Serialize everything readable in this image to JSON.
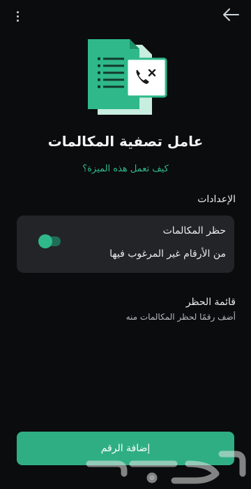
{
  "header": {
    "menu_icon": "more-vertical-icon",
    "back_icon": "arrow-left-icon"
  },
  "illustration": {
    "icon": "blocked-call-document-icon",
    "accent_color": "#2fb98b"
  },
  "page": {
    "title": "عامل تصفية المكالمات",
    "help_link": "كيف تعمل هذه الميزة؟"
  },
  "settings": {
    "heading": "الإعدادات",
    "call_block": {
      "title": "حظر المكالمات",
      "subtitle": "من الأرقام غير المرغوب فيها",
      "enabled": true
    },
    "block_list": {
      "title": "قائمة الحظر",
      "subtitle": "أضف رقمًا لحظر المكالمات منه"
    }
  },
  "actions": {
    "add_number_label": "إضافة الرقم"
  },
  "colors": {
    "background": "#0b0c0d",
    "card": "#222428",
    "accent": "#2fb98b",
    "button": "#2fae84"
  }
}
